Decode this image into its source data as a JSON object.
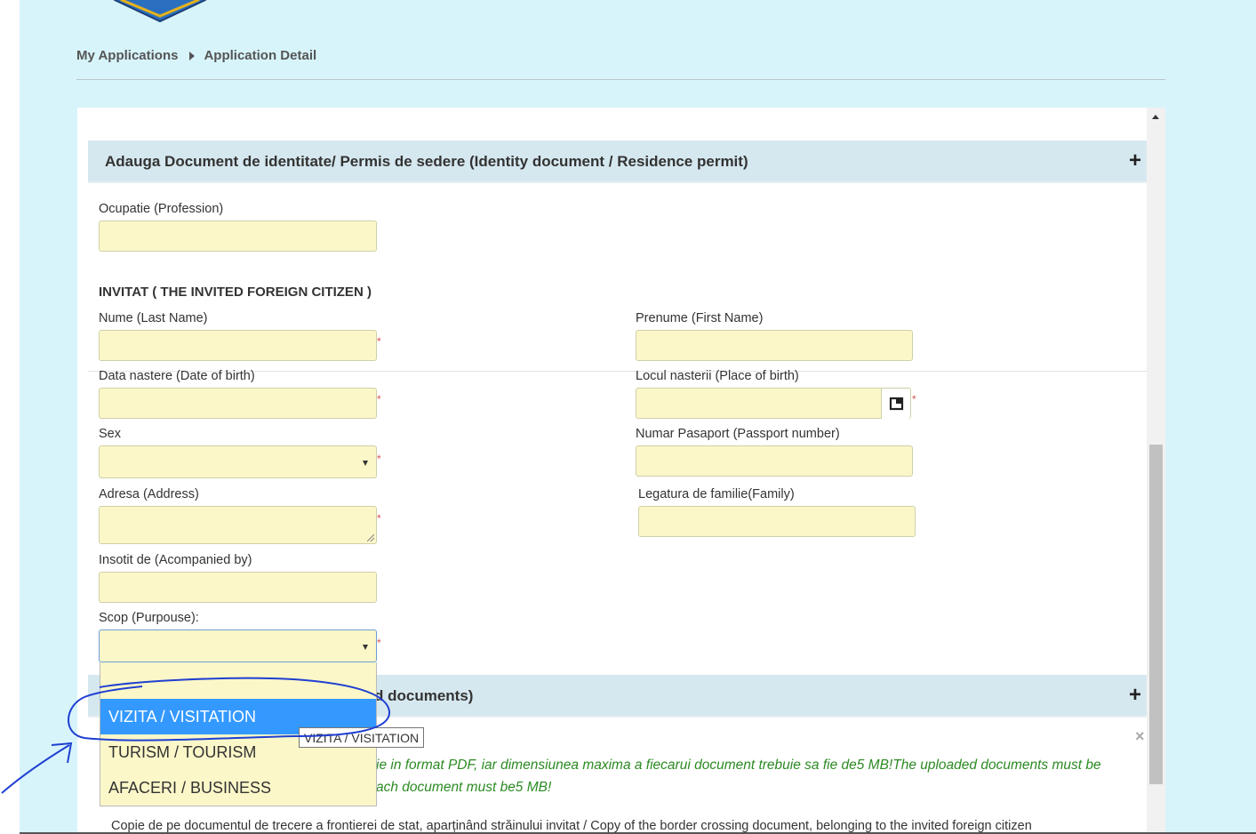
{
  "breadcrumb": {
    "item1": "My Applications",
    "item2": "Application Detail"
  },
  "sections": {
    "identity_doc": "Adauga Document de identitate/ Permis de sedere (Identity document / Residence permit)",
    "documents_partial": "d documents)"
  },
  "fields": {
    "profession": "Ocupatie (Profession)",
    "invited_heading": "INVITAT ( THE INVITED FOREIGN CITIZEN )",
    "last_name": "Nume (Last Name)",
    "first_name": "Prenume (First Name)",
    "dob": "Data nastere (Date of birth)",
    "pob": "Locul nasterii (Place of birth)",
    "sex": "Sex",
    "passport": "Numar Pasaport (Passport number)",
    "address": "Adresa (Address)",
    "family": "Legatura de familie(Family)",
    "accompanied": "Insotit de (Acompanied by)",
    "purpose": "Scop (Purpouse):"
  },
  "required_mark": "*",
  "plus_icon": "+",
  "close_icon": "×",
  "purpose_options": [
    "",
    "VIZITA / VISITATION",
    "TURISM / TOURISM",
    "AFACERI / BUSINESS"
  ],
  "tooltip": "VIZITA / VISITATION",
  "alert": {
    "line1": "ie in format PDF, iar dimensiunea maxima a fiecarui document trebuie sa fie de5 MB!The uploaded documents must be",
    "line2": "ach document must be5 MB!"
  },
  "bottom_text": "Copie de pe documentul de trecere a frontierei de stat, aparținând străinului invitat / Copy of the border crossing document, belonging to the invited foreign citizen",
  "colors": {
    "field_bg": "#fbf7c8",
    "page_bg": "#d7f4fb",
    "section_bg": "#d6e8ef",
    "selected": "#3399ff",
    "alert_green": "#2b8a22",
    "annotation": "#1f3fd1"
  }
}
